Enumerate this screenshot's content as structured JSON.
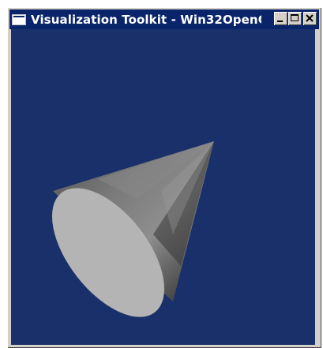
{
  "window": {
    "title": "Visualization Toolkit - Win32OpenG...",
    "icon": "window-icon",
    "controls": {
      "minimize_icon": "minimize-icon",
      "maximize_icon": "maximize-icon",
      "close_icon": "close-icon"
    }
  },
  "viewport": {
    "background_color": "#19306a",
    "object": "cone",
    "cone_base_color": "#b4b4b4",
    "cone_body_color": "#6e6e6e"
  }
}
